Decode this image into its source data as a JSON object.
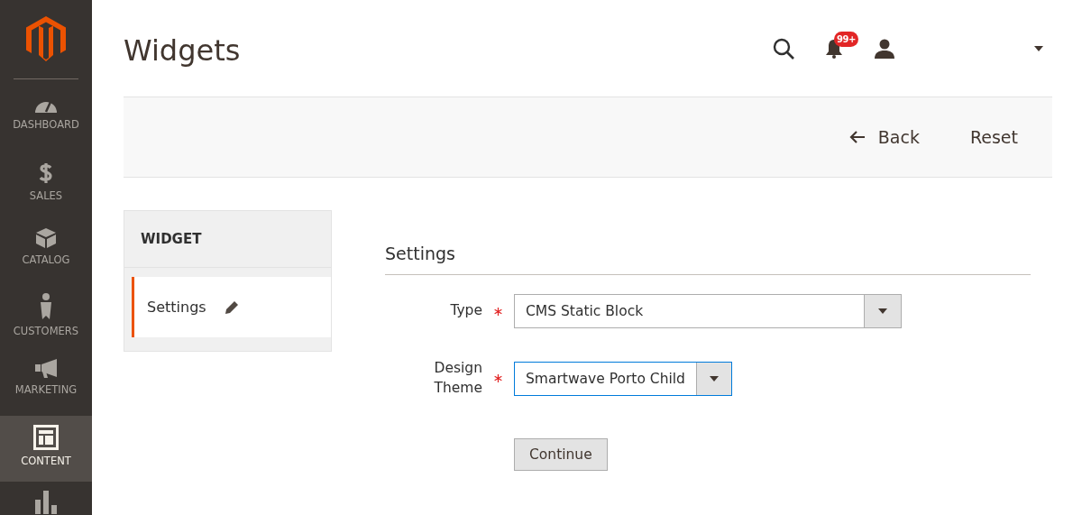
{
  "sidebar": {
    "items": [
      {
        "kind": "dashboard",
        "label": "DASHBOARD",
        "selected": false
      },
      {
        "kind": "sales",
        "label": "SALES",
        "selected": false
      },
      {
        "kind": "catalog",
        "label": "CATALOG",
        "selected": false
      },
      {
        "kind": "customers",
        "label": "CUSTOMERS",
        "selected": false
      },
      {
        "kind": "marketing",
        "label": "MARKETING",
        "selected": false
      },
      {
        "kind": "content",
        "label": "CONTENT",
        "selected": true
      },
      {
        "kind": "reports",
        "selected": false
      }
    ]
  },
  "header": {
    "title": "Widgets",
    "notifications_badge": "99+"
  },
  "actions": {
    "back": "Back",
    "reset": "Reset"
  },
  "tabs_panel": {
    "title": "WIDGET",
    "tabs": [
      {
        "label": "Settings",
        "selected": true
      }
    ]
  },
  "form": {
    "section_title": "Settings",
    "fields": [
      {
        "label": "Type",
        "required": true,
        "value": "CMS Static Block",
        "focused": false,
        "wide": true
      },
      {
        "label": "Design Theme",
        "required": true,
        "value": "Smartwave Porto Child",
        "focused": true,
        "wide": false
      }
    ],
    "submit": "Continue"
  }
}
